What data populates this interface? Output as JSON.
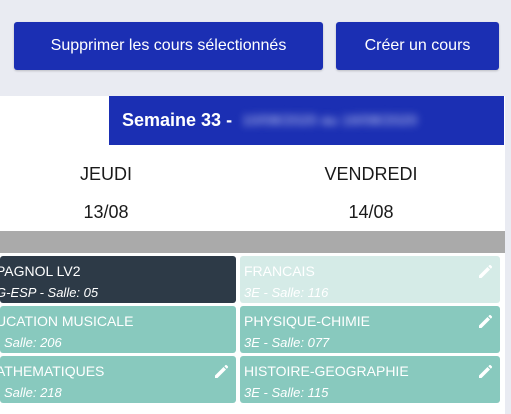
{
  "toolbar": {
    "delete_selected_label": "Supprimer les cours sélectionnés",
    "create_course_label": "Créer un cours"
  },
  "week": {
    "label": "Semaine 33 -",
    "dates_blurred": "10/08/2020 au 16/08/2020"
  },
  "days": [
    {
      "name": "JEUDI",
      "date": "13/08"
    },
    {
      "name": "VENDREDI",
      "date": "14/08"
    }
  ],
  "courses_thursday": [
    {
      "title": "PAGNOL LV2",
      "subtitle": "G-ESP - Salle: 05",
      "style": "dark"
    },
    {
      "title": "UCATION MUSICALE",
      "subtitle": "- Salle: 206",
      "style": "green"
    },
    {
      "title": "ATHEMATIQUES",
      "subtitle": "- Salle: 218",
      "style": "green"
    }
  ],
  "courses_friday": [
    {
      "title": "FRANCAIS",
      "subtitle": "3E - Salle: 116",
      "style": "pale"
    },
    {
      "title": "PHYSIQUE-CHIMIE",
      "subtitle": "3E - Salle: 077",
      "style": "green"
    },
    {
      "title": "HISTOIRE-GEOGRAPHIE",
      "subtitle": "3E - Salle: 115",
      "style": "green"
    }
  ],
  "colors": {
    "primary": "#1b2fb3",
    "course_dark": "#2d3a47",
    "course_green": "#88c9be",
    "course_pale": "#d5ebe7",
    "separator_gray": "#aaaaaa"
  },
  "icons": {
    "edit": "pencil-icon"
  }
}
